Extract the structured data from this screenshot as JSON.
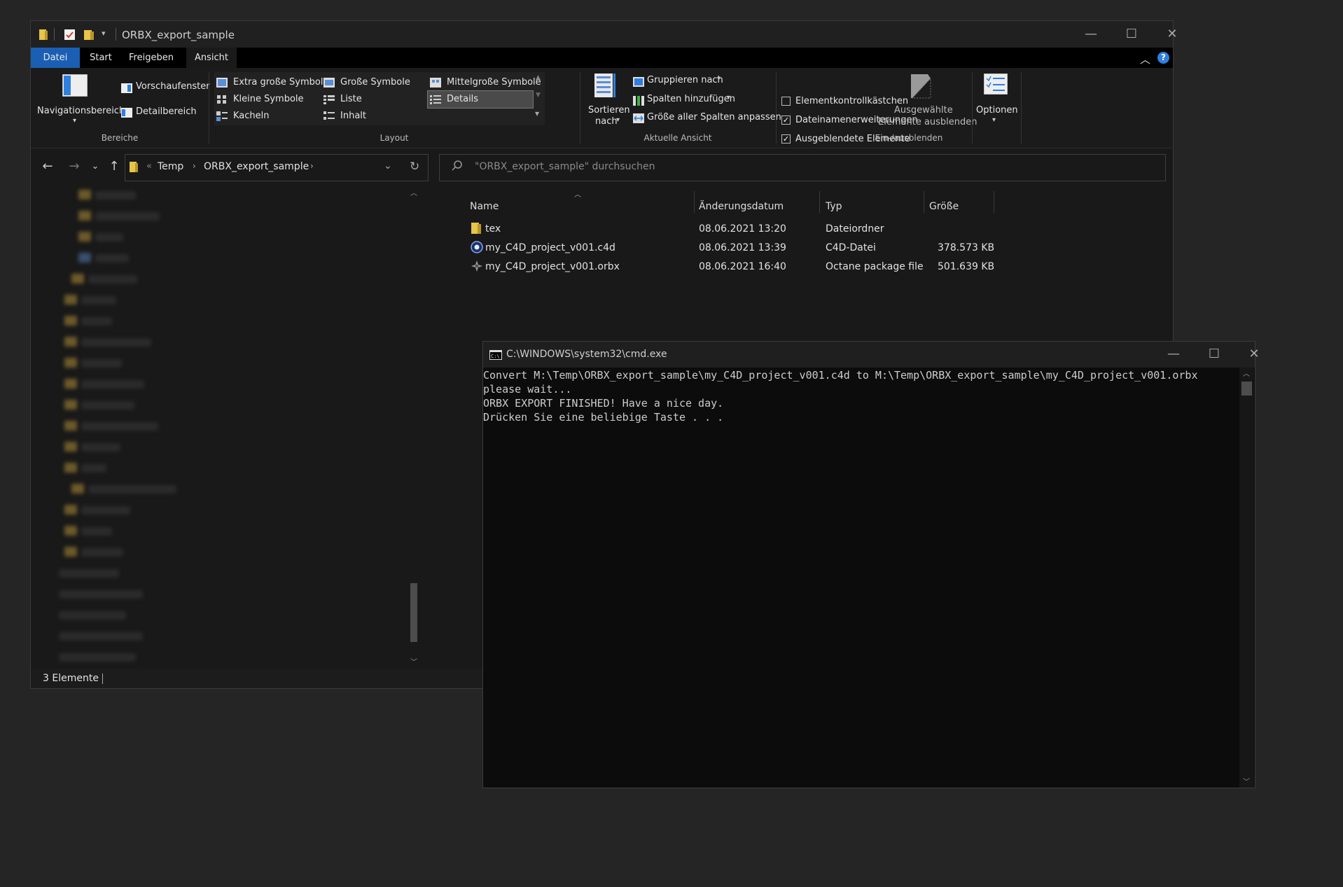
{
  "explorer": {
    "title": "ORBX_export_sample",
    "tabs": [
      "Datei",
      "Start",
      "Freigeben",
      "Ansicht"
    ],
    "ribbon": {
      "bereiche": {
        "navigationsbereich": "Navigationsbereich",
        "vorschaufenster": "Vorschaufenster",
        "detailbereich": "Detailbereich",
        "label": "Bereiche"
      },
      "layout": {
        "items": [
          "Extra große Symbole",
          "Große Symbole",
          "Mittelgroße Symbole",
          "Kleine Symbole",
          "Liste",
          "Details",
          "Kacheln",
          "Inhalt"
        ],
        "selected": "Details",
        "label": "Layout"
      },
      "aktuelle_ansicht": {
        "sortieren": "Sortieren",
        "nach": "nach",
        "gruppieren": "Gruppieren nach",
        "spalten": "Spalten hinzufügen",
        "groesse": "Größe aller Spalten anpassen",
        "label": "Aktuelle Ansicht"
      },
      "ein_ausblenden": {
        "elementkontrollkaestchen": "Elementkontrollkästchen",
        "dateinamenerweiterungen": "Dateinamenerweiterungen",
        "ausgeblendete_elemente": "Ausgeblendete Elemente",
        "ausgewaehlte": "Ausgewählte",
        "elemente_ausblenden": "Elemente ausblenden",
        "optionen": "Optionen",
        "label": "Ein-/ausblenden",
        "checked": [
          false,
          true,
          true
        ]
      }
    },
    "address": {
      "overflow": "«",
      "crumbs": [
        "Temp",
        "ORBX_export_sample"
      ]
    },
    "search": {
      "placeholder": "\"ORBX_export_sample\" durchsuchen"
    },
    "columns": [
      "Name",
      "Änderungsdatum",
      "Typ",
      "Größe"
    ],
    "files": [
      {
        "name": "tex",
        "date": "08.06.2021 13:20",
        "type": "Dateiordner",
        "size": "",
        "icon": "folder-icon"
      },
      {
        "name": "my_C4D_project_v001.c4d",
        "date": "08.06.2021 13:39",
        "type": "C4D-Datei",
        "size": "378.573 KB",
        "icon": "c4d-file-icon"
      },
      {
        "name": "my_C4D_project_v001.orbx",
        "date": "08.06.2021 16:40",
        "type": "Octane package file",
        "size": "501.639 KB",
        "icon": "orbx-file-icon"
      }
    ],
    "status": "3 Elemente"
  },
  "cmd": {
    "title": "C:\\WINDOWS\\system32\\cmd.exe",
    "lines": [
      "Convert M:\\Temp\\ORBX_export_sample\\my_C4D_project_v001.c4d to M:\\Temp\\ORBX_export_sample\\my_C4D_project_v001.orbx",
      "please wait...",
      "ORBX EXPORT FINISHED! Have a nice day.",
      "Drücken Sie eine beliebige Taste . . ."
    ]
  },
  "colors": {
    "accent": "#1a5fb4",
    "folder": "#e8c44a",
    "background": "#252525"
  }
}
